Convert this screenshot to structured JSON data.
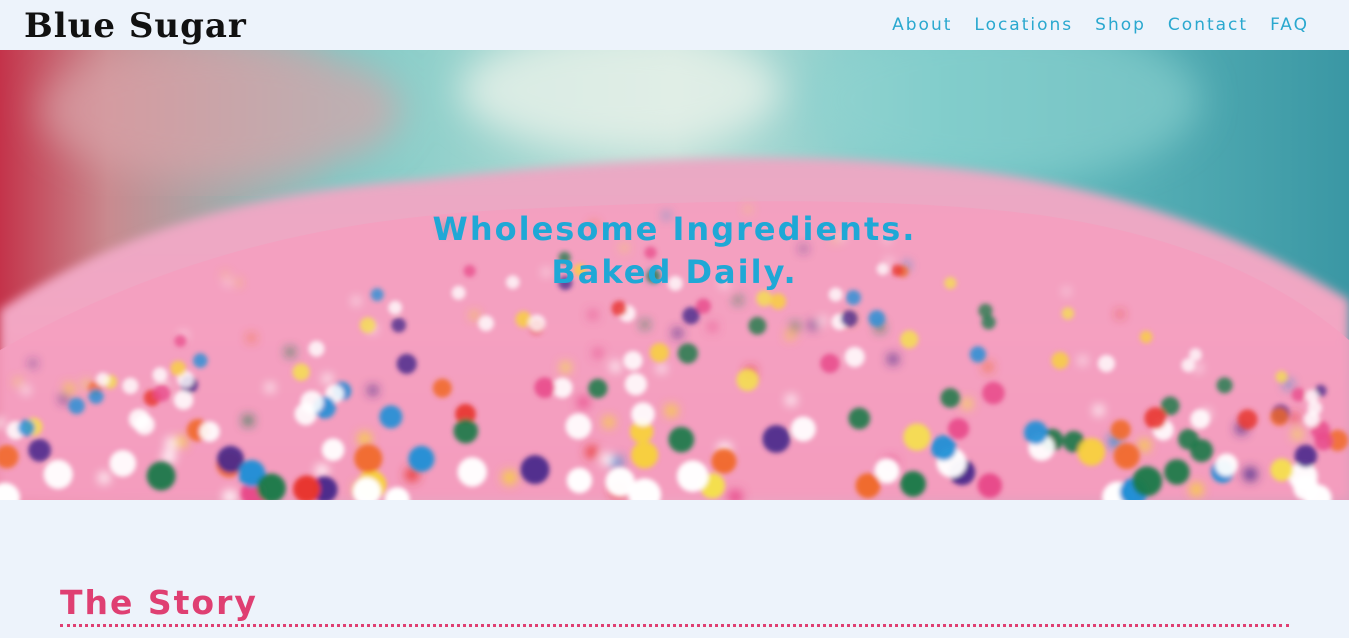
{
  "brand": {
    "name": "Blue Sugar"
  },
  "nav": {
    "items": [
      {
        "label": "About"
      },
      {
        "label": "Locations"
      },
      {
        "label": "Shop"
      },
      {
        "label": "Contact"
      },
      {
        "label": "FAQ"
      }
    ]
  },
  "hero": {
    "headline_line1": "Wholesome Ingredients.",
    "headline_line2": "Baked Daily.",
    "image": "pink-frosting-sprinkles-photo"
  },
  "story": {
    "title": "The Story"
  },
  "colors": {
    "background": "#edf3fb",
    "nav_link": "#2aa8cf",
    "hero_text": "#1fa8d6",
    "section_title": "#df3f72",
    "brand_text": "#111111"
  }
}
